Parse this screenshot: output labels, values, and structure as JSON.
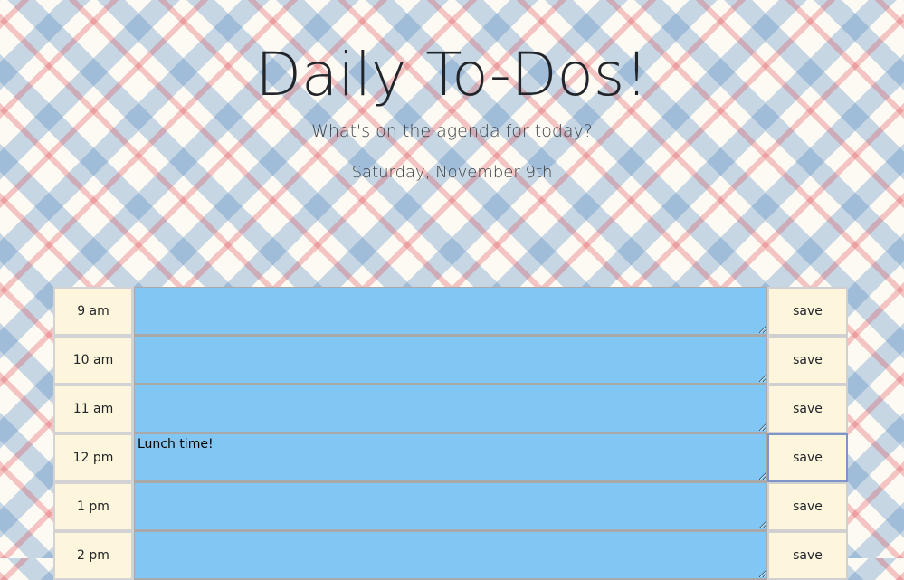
{
  "header": {
    "title": "Daily To-Dos!",
    "subtitle": "What's on the agenda for today?",
    "date": "Saturday, November 9th"
  },
  "colors": {
    "past": "#d3d3d3",
    "present": "#82c7f4",
    "hour_block": "#fdf6dc"
  },
  "rows": [
    {
      "hour": "9 am",
      "task": "",
      "save_label": "save"
    },
    {
      "hour": "10 am",
      "task": "",
      "save_label": "save"
    },
    {
      "hour": "11 am",
      "task": "",
      "save_label": "save"
    },
    {
      "hour": "12 pm",
      "task": "Lunch time!",
      "save_label": "save"
    },
    {
      "hour": "1 pm",
      "task": "",
      "save_label": "save"
    },
    {
      "hour": "2 pm",
      "task": "",
      "save_label": "save"
    }
  ]
}
